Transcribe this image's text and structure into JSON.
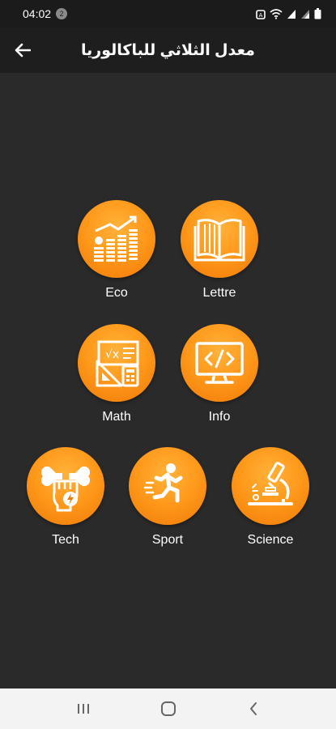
{
  "status_bar": {
    "time": "04:02",
    "notification_count": "2",
    "icons": [
      "alarm-icon",
      "wifi-icon",
      "signal-icon",
      "signal-icon",
      "battery-icon"
    ]
  },
  "app_bar": {
    "title": "معدل الثلاثي للباكالوريا",
    "back_icon": "arrow-left-icon"
  },
  "tiles": [
    {
      "label": "Eco",
      "icon": "chart-growth-icon"
    },
    {
      "label": "Lettre",
      "icon": "open-book-icon"
    },
    {
      "label": "Math",
      "icon": "math-tools-icon"
    },
    {
      "label": "Info",
      "icon": "computer-code-icon"
    },
    {
      "label": "Tech",
      "icon": "wrench-fist-icon"
    },
    {
      "label": "Sport",
      "icon": "runner-icon"
    },
    {
      "label": "Science",
      "icon": "microscope-icon"
    }
  ],
  "nav_bar": {
    "buttons": [
      "recent-apps-icon",
      "home-icon",
      "back-icon"
    ]
  },
  "colors": {
    "background": "#2a2a2a",
    "app_bar": "#1e1e1e",
    "accent": "#ff9a1c",
    "accent_dark": "#f07a06"
  }
}
